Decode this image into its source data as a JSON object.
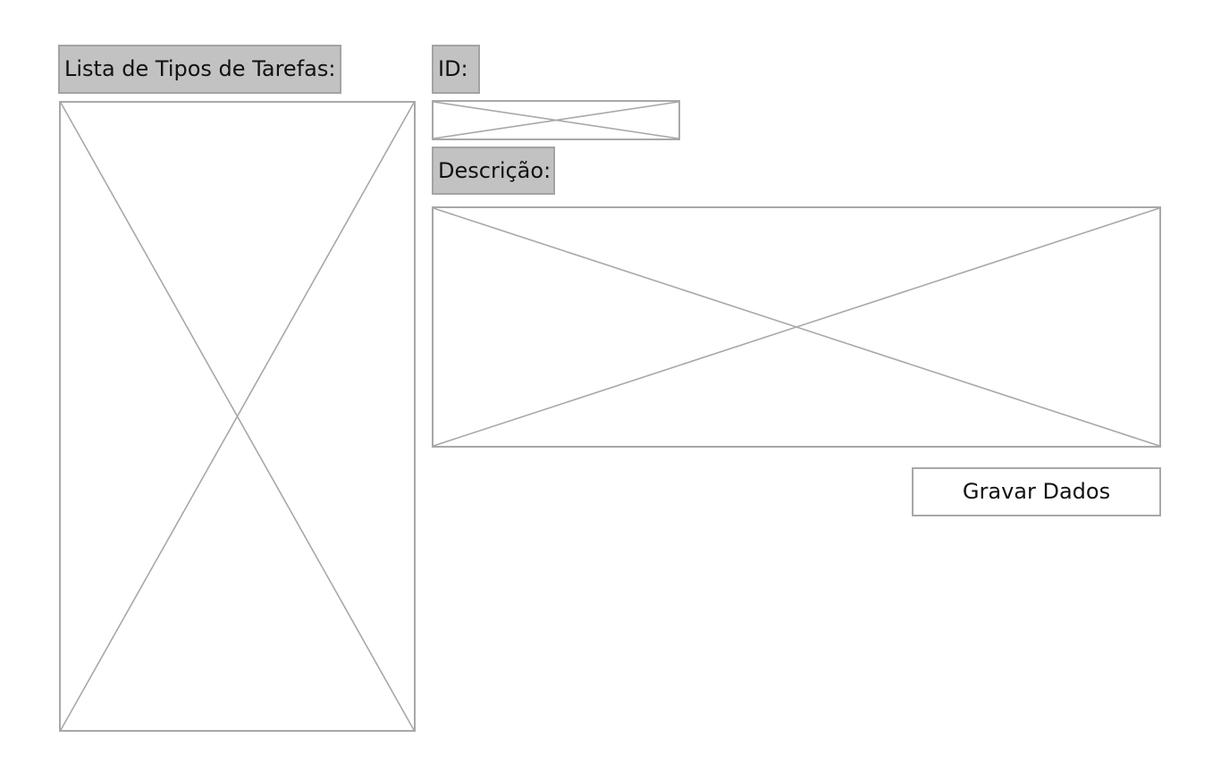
{
  "list_panel": {
    "label": "Lista de Tipos de Tarefas:"
  },
  "form": {
    "id_label": "ID:",
    "description_label": "Descrição:",
    "save_button_label": "Gravar Dados"
  },
  "colors": {
    "label_background": "#c2c2c2",
    "border": "#a8a8a8"
  }
}
